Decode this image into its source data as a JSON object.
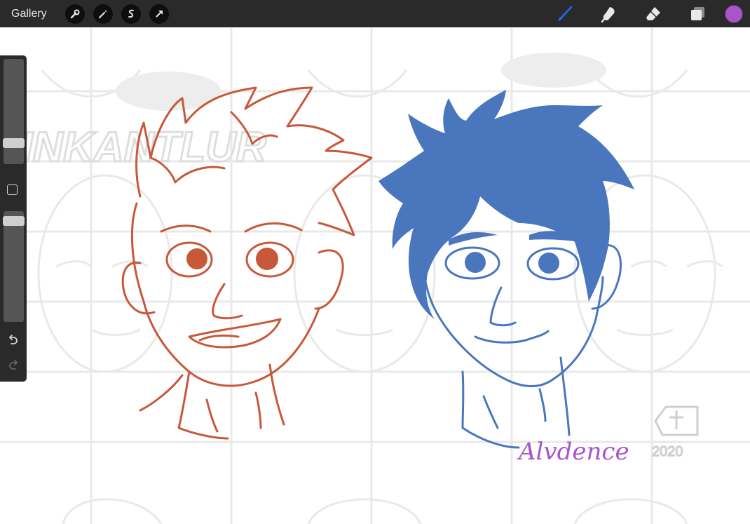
{
  "toolbar": {
    "gallery_label": "Gallery",
    "left_tools": [
      "wrench-icon",
      "magic-wand-icon",
      "selection-icon",
      "transform-arrow-icon"
    ],
    "right_tools": [
      "brush-icon",
      "smudge-icon",
      "eraser-icon",
      "layers-icon"
    ],
    "active_tool": "brush",
    "brush_color": "#a855c7",
    "active_tool_color": "#1a6ef5"
  },
  "sidebar": {
    "brush_size_level": 0.77,
    "opacity_level": 0.85,
    "undo": "undo-icon",
    "redo": "redo-icon"
  },
  "artwork": {
    "left_line_color": "#c8583a",
    "right_fill_color": "#4a76bd",
    "signature": "Alvdence",
    "watermark_text": "INKANTLUR",
    "watermark_year": "2020"
  }
}
